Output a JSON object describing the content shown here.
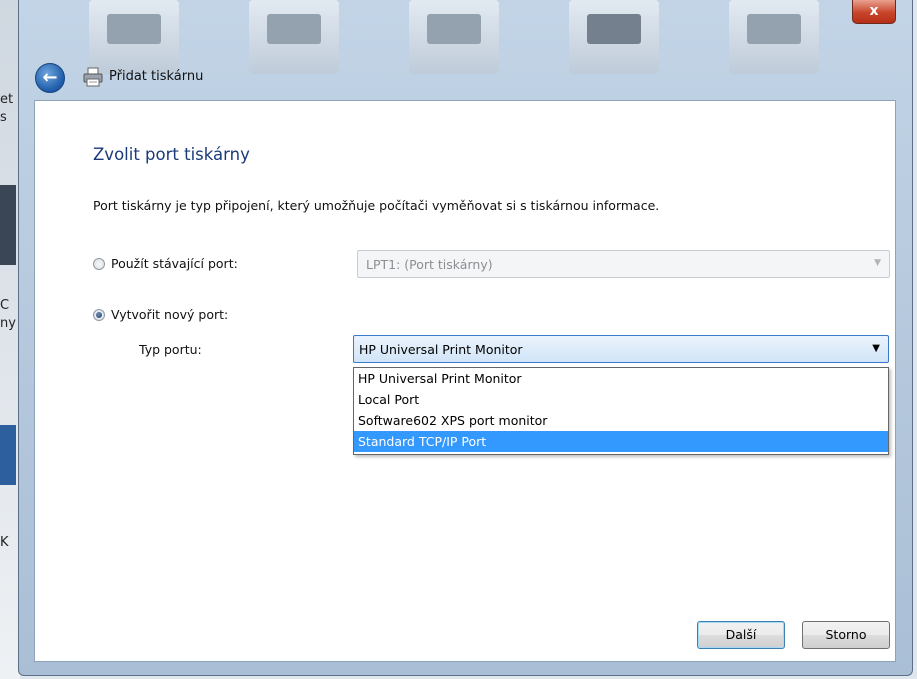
{
  "window": {
    "title": "Přidat tiskárnu",
    "close_symbol": "x",
    "back_symbol": "←"
  },
  "page": {
    "heading": "Zvolit port tiskárny",
    "description": "Port tiskárny je typ připojení, který umožňuje počítači vyměňovat si s tiskárnou informace."
  },
  "existing_port": {
    "label": "Použít stávající port:",
    "value": "LPT1: (Port tiskárny)",
    "checked": false,
    "enabled": false
  },
  "new_port": {
    "label": "Vytvořit nový port:",
    "checked": true,
    "type_label": "Typ portu:",
    "selected": "HP Universal Print Monitor",
    "options": [
      "HP Universal Print Monitor",
      "Local Port",
      "Software602 XPS port monitor",
      "Standard TCP/IP Port"
    ],
    "highlighted_index": 3
  },
  "buttons": {
    "next": "Další",
    "cancel": "Storno"
  },
  "background": {
    "left_text": [
      "et",
      "s",
      "C",
      "ny",
      "K"
    ]
  },
  "colors": {
    "heading": "#1b3a7a",
    "highlight": "#3399ff",
    "close": "#c8452b"
  }
}
